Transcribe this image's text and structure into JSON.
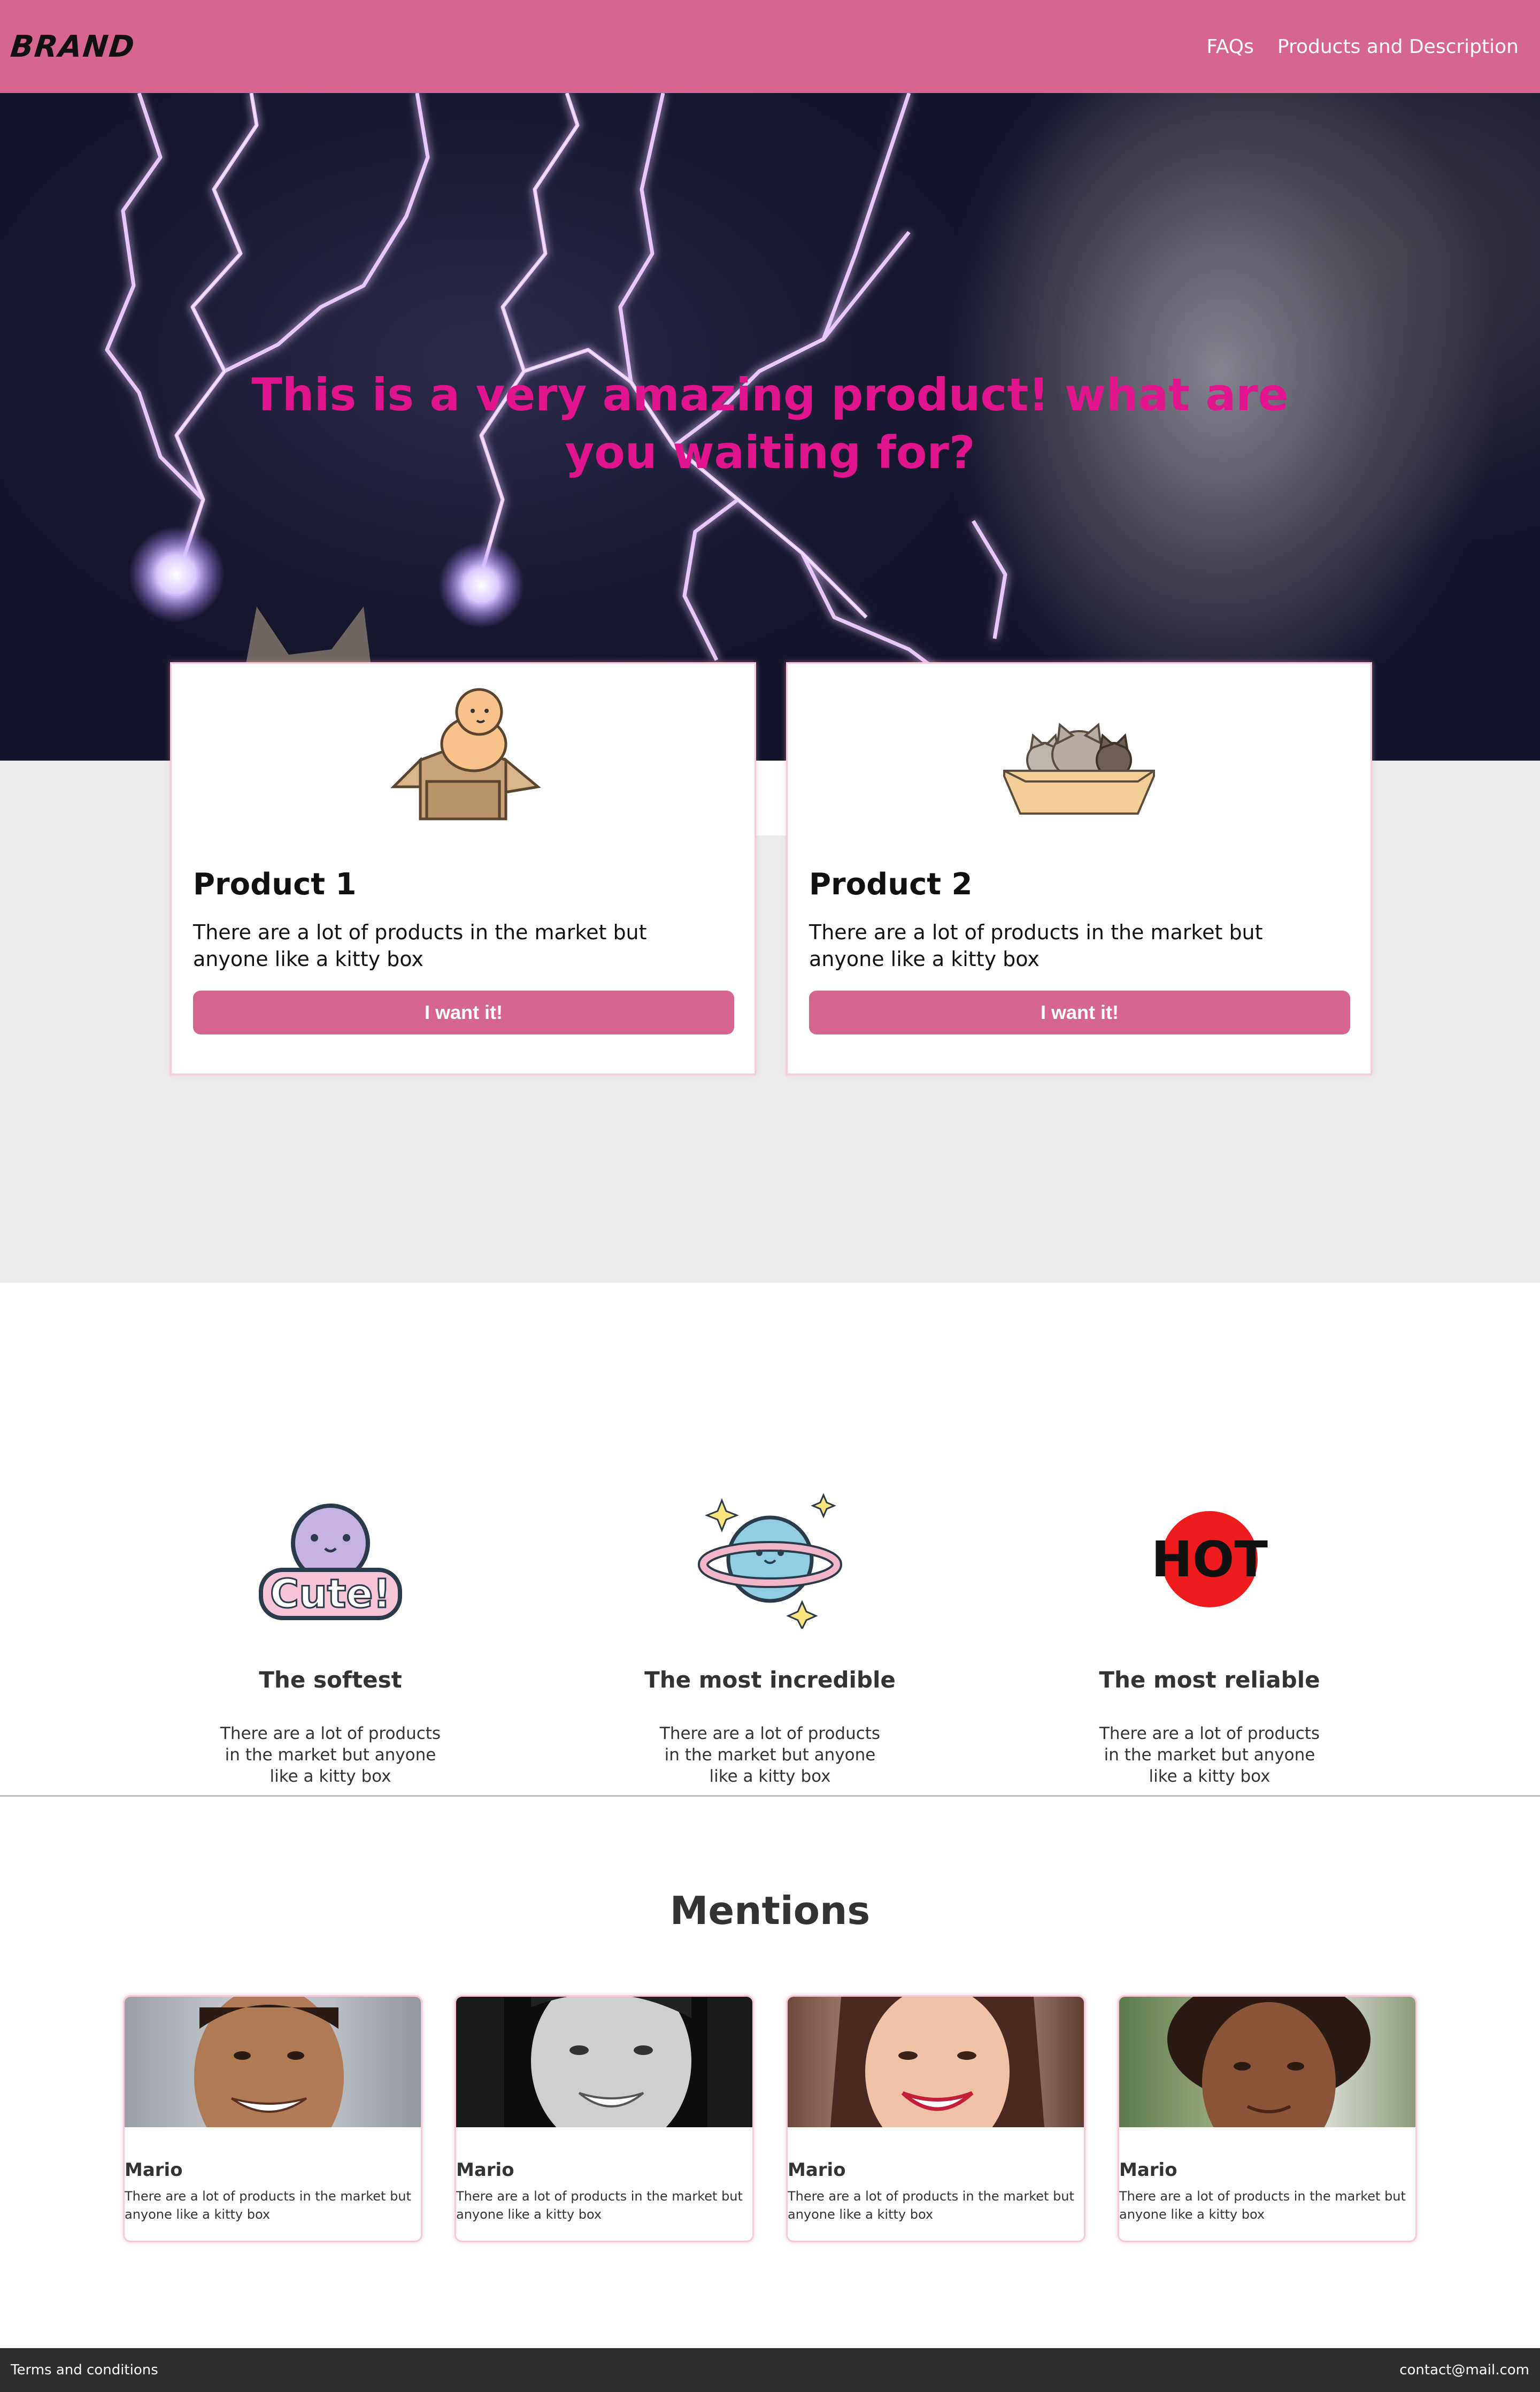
{
  "nav": {
    "brand": "BRAND",
    "links": [
      "FAQs",
      "Products and Description"
    ]
  },
  "hero": {
    "title": "This is a very amazing product! what are you waiting for?"
  },
  "products": [
    {
      "title": "Product 1",
      "description": "There are a lot of products in the market but anyone like a kitty box",
      "button": "I want it!",
      "icon": "baby-in-box-illustration"
    },
    {
      "title": "Product 2",
      "description": "There are a lot of products in the market but anyone like a kitty box",
      "button": "I want it!",
      "icon": "cats-in-box-illustration"
    }
  ],
  "features": [
    {
      "title": "The softest",
      "description": "There are a lot of products in the market but anyone like a kitty box",
      "icon": "cute-sticker-icon",
      "icon_text": "Cute!"
    },
    {
      "title": "The most incredible",
      "description": "There are a lot of products in the market but anyone like a kitty box",
      "icon": "planet-icon"
    },
    {
      "title": "The most reliable",
      "description": "There are a lot of products in the market but anyone like a kitty box",
      "icon": "hot-sticker-icon",
      "icon_text": "HOT"
    }
  ],
  "mentions": {
    "title": "Mentions",
    "items": [
      {
        "name": "Mario",
        "text": "There are a lot of products in the market but anyone like a kitty box"
      },
      {
        "name": "Mario",
        "text": "There are a lot of products in the market but anyone like a kitty box"
      },
      {
        "name": "Mario",
        "text": "There are a lot of products in the market but anyone like a kitty box"
      },
      {
        "name": "Mario",
        "text": "There are a lot of products in the market but anyone like a kitty box"
      }
    ]
  },
  "footer": {
    "left": "Terms and conditions",
    "right": "contact@mail.com"
  },
  "colors": {
    "accent": "#d6658f",
    "hero_title": "#e0158e",
    "footer_bg": "#2e2e30",
    "section_grey": "#ececec"
  }
}
